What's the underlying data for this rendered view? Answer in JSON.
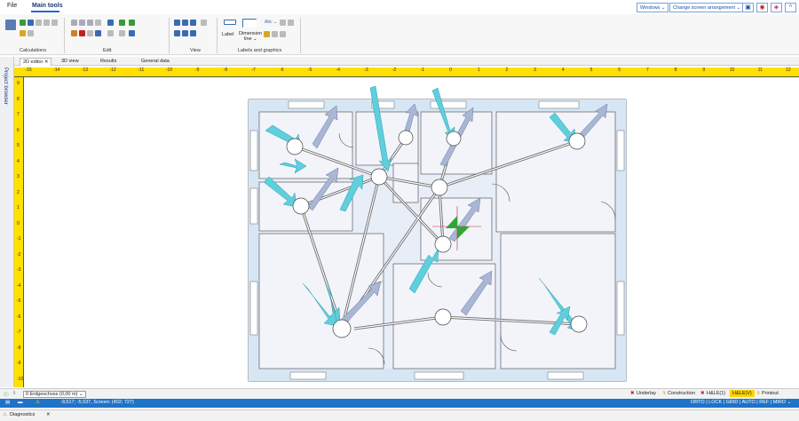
{
  "menu": {
    "file": "File",
    "main_tools": "Main tools"
  },
  "topbar": {
    "windows": "Windows ⌄",
    "change_arrangement": "Change screen arrangement ⌄"
  },
  "ribbon": {
    "groups": {
      "calculations": "Calculations",
      "edit": "Edit",
      "view": "View",
      "labels_graphics": "Labels and graphics"
    },
    "label_btn": "Label",
    "dimension_btn": "Dimension",
    "dimension_btn2": "line ⌄",
    "abc": "Abc ⌄"
  },
  "tabs": {
    "editor2d": "2D editor",
    "view3d": "3D view",
    "results": "Results",
    "general": "General data"
  },
  "sidepanel": {
    "label": "Project browser"
  },
  "ruler": {
    "labels": [
      "-15",
      "-14",
      "-13",
      "-12",
      "-11",
      "-10",
      "-9",
      "-8",
      "-7",
      "-6",
      "-5",
      "-4",
      "-3",
      "-2",
      "-1",
      "0",
      "1",
      "2",
      "3",
      "4",
      "5",
      "6",
      "7",
      "8",
      "9",
      "10",
      "11",
      "12"
    ],
    "vlabels": [
      "9",
      "8",
      "7",
      "6",
      "5",
      "4",
      "3",
      "2",
      "1",
      "0",
      "-1",
      "-2",
      "-3",
      "-4",
      "-5",
      "-6",
      "-7",
      "-8",
      "-9",
      "-10"
    ]
  },
  "floor": {
    "selector": "0 Erdgeschoss (0,00 m) ⌄"
  },
  "bottom_right": {
    "underlay": "Underlay",
    "construction": "Construction",
    "hle1": "H&LE(1)",
    "hle_v": "H&LE(V)",
    "printout": "Printout"
  },
  "status": {
    "coords": "-9,517; -5,537, Screen: (402; 727)",
    "right": "ORTO | LOCK | GRID | AUTO | REF | MIRO ⌄"
  },
  "diagnostics": {
    "label": "Diagnostics"
  },
  "colors": {
    "accent": "#1f73c7",
    "ruler": "#ffe000",
    "air": "#5fcfdc",
    "wall": "#d7e6f5"
  }
}
